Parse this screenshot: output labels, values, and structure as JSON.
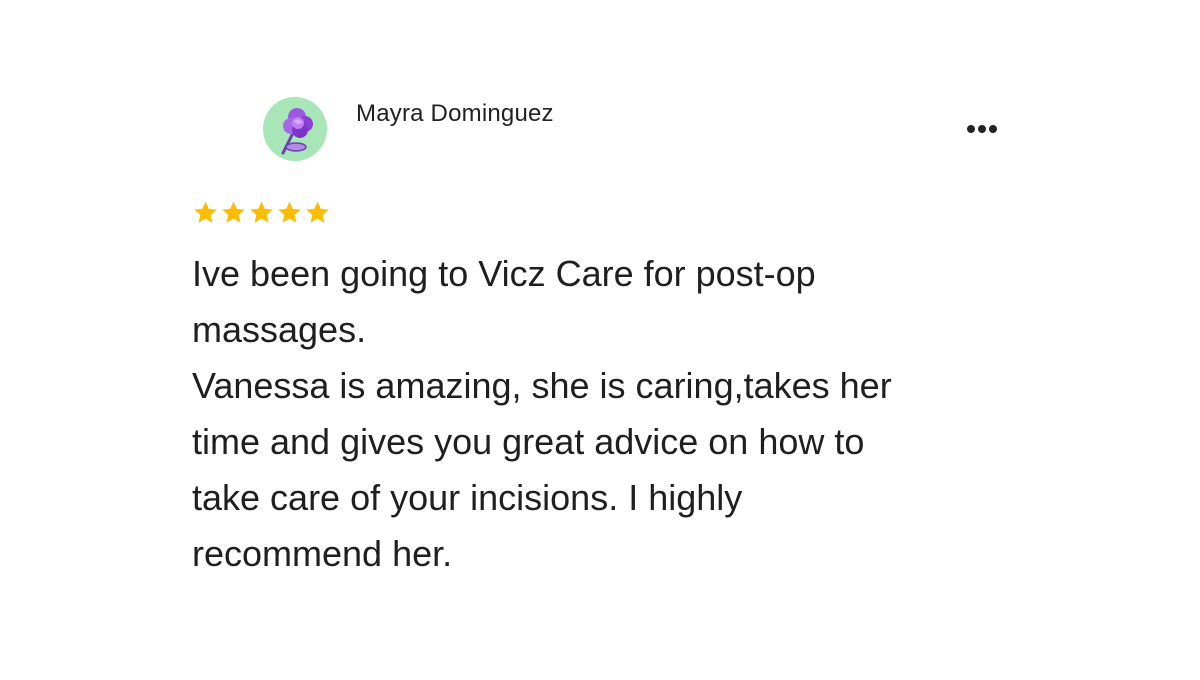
{
  "review": {
    "reviewer_name": "Mayra Dominguez",
    "rating": 5,
    "max_rating": 5,
    "star_color": "#FBBC04",
    "lines": [
      "Ive been going to Vicz Care for post-op",
      "massages.",
      "Vanessa is amazing, she is caring,takes her",
      "time and gives you great advice on how to",
      "take care of your incisions. I highly",
      "recommend her."
    ]
  },
  "icons": {
    "avatar": "flower-avatar-icon",
    "more": "more-options-icon",
    "star": "star-icon"
  }
}
